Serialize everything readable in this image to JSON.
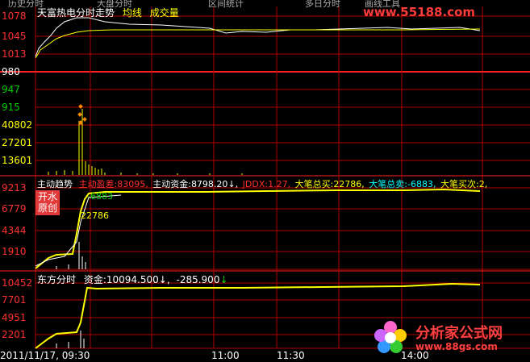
{
  "topbar": {
    "items": [
      "历史分时",
      "大盘分时",
      "区间统计",
      "多日分时",
      "画线工具"
    ]
  },
  "logo_url": "www.55188.com",
  "panel1": {
    "title": "天富热电分时走势",
    "avg_label": "均线",
    "vol_label": "成交量",
    "price_ticks": [
      "1078",
      "1045",
      "1013",
      "980",
      "947",
      "915"
    ],
    "vol_ticks": [
      "40802",
      "27201",
      "13601"
    ]
  },
  "panel2": {
    "title": "主动趋势",
    "buy_diff_label": "主动盈差:",
    "buy_diff_value": "83095,",
    "active_fund_label": "主动资金:",
    "active_fund_value": "8798.20",
    "ddx_label": "JDDX:",
    "ddx_value": "1.27,",
    "big_buy_label": "大笔总买:",
    "big_buy_value": "22786,",
    "big_sell_label": "大笔总卖:",
    "big_sell_value": "-6883,",
    "big_count_label": "大笔买次:",
    "big_count_value": "2,",
    "ticks": [
      "9213",
      "6779",
      "4344",
      "1910"
    ],
    "badge_line1": "开水",
    "badge_line2": "原创",
    "annot_sell": "-6883",
    "annot_buy": "22786"
  },
  "panel3": {
    "title": "东方分时",
    "fund_label": "资金:",
    "fund_value": "10094.500",
    "fund_delta": "-285.900",
    "ticks": [
      "10452",
      "7701",
      "4951",
      "2201"
    ]
  },
  "time_axis": {
    "labels": [
      "2011/11/17, 09:30",
      "11:00",
      "11:30",
      "14:00"
    ]
  },
  "watermark": {
    "line1": "分析家公式网",
    "line2": "www.88gs.com"
  },
  "colors": {
    "grid": "#b00000",
    "price": "#ffffff",
    "avg": "#ffff00",
    "up": "#ff3030",
    "down": "#00d000",
    "text_yellow": "#ffff00"
  }
}
